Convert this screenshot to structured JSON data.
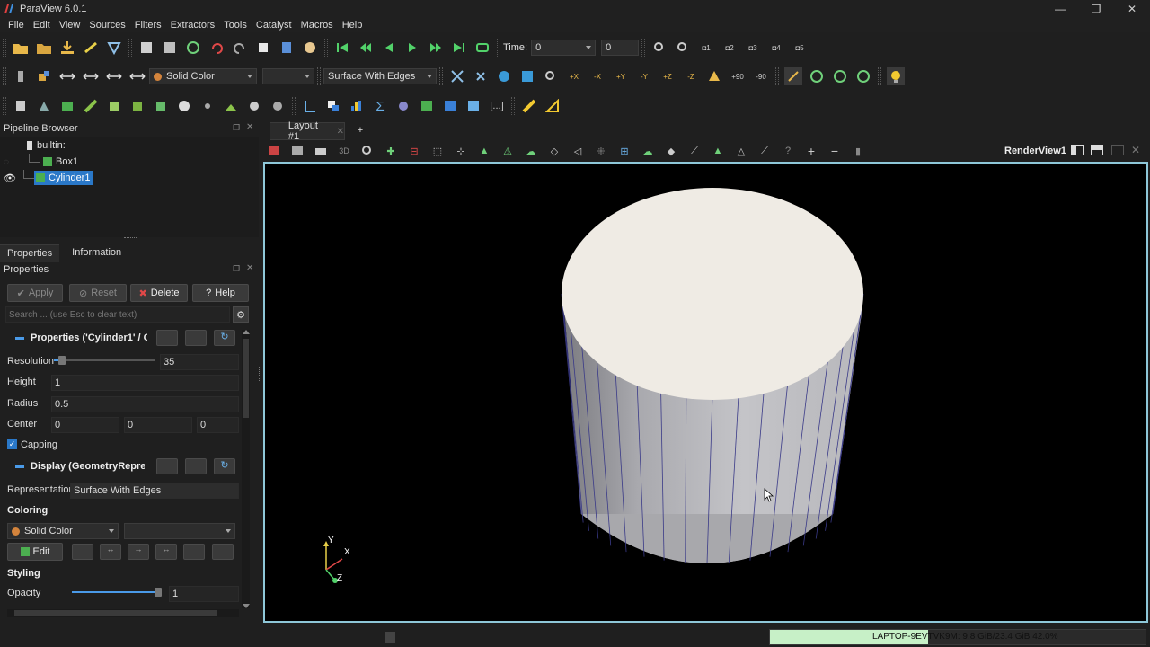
{
  "window": {
    "title": "ParaView 6.0.1",
    "minimize": "—",
    "maximize": "❐",
    "close": "✕"
  },
  "menu": [
    "File",
    "Edit",
    "View",
    "Sources",
    "Filters",
    "Extractors",
    "Tools",
    "Catalyst",
    "Macros",
    "Help"
  ],
  "toolbar": {
    "time_label": "Time:",
    "time_value": "0",
    "time_step": "0",
    "color_mode": "Solid Color",
    "color_component": "",
    "representation": "Surface With Edges",
    "camera_labels": [
      "+X",
      "-X",
      "+Y",
      "-Y",
      "+Z",
      "-Z",
      "+90",
      "-90"
    ],
    "camera_slots": [
      "1",
      "2",
      "3",
      "4",
      "5"
    ]
  },
  "pipeline": {
    "title": "Pipeline Browser",
    "root": "builtin:",
    "items": [
      {
        "label": "Box1",
        "visible": false,
        "selected": false
      },
      {
        "label": "Cylinder1",
        "visible": true,
        "selected": true
      }
    ]
  },
  "tabs": [
    "Properties",
    "Information"
  ],
  "properties": {
    "title": "Properties",
    "apply": "Apply",
    "reset": "Reset",
    "delete": "Delete",
    "help": "Help",
    "search_placeholder": "Search ... (use Esc to clear text)",
    "section_props": "Properties ('Cylinder1' / Cy",
    "resolution_label": "Resolution",
    "resolution_value": "35",
    "resolution_fraction": 0.05,
    "height_label": "Height",
    "height_value": "1",
    "radius_label": "Radius",
    "radius_value": "0.5",
    "center_label": "Center",
    "center_x": "0",
    "center_y": "0",
    "center_z": "0",
    "capping_label": "Capping",
    "capping_checked": true,
    "section_display": "Display (GeometryRepresei",
    "representation_label": "Representation",
    "representation_value": "Surface With Edges",
    "coloring_label": "Coloring",
    "coloring_value": "Solid Color",
    "edit_label": "Edit",
    "styling_label": "Styling",
    "opacity_label": "Opacity",
    "opacity_value": "1",
    "opacity_fraction": 1.0
  },
  "layout": {
    "tab_label": "Layout #1",
    "add_tab": "+",
    "view_mode": "3D",
    "render_view_label": "RenderView1"
  },
  "axes": {
    "x": "X",
    "y": "Y",
    "z": "Z"
  },
  "status": {
    "memory": "LAPTOP-9EVTVK9M: 9.8 GiB/23.4 GiB 42.0%",
    "memory_fraction": 0.42
  },
  "colors": {
    "accent_selected": "#2a78c8",
    "viewport_border": "#8ec7d8",
    "memory_bar": "#c7f0c7",
    "cylinder_cap": "#efebe4"
  }
}
